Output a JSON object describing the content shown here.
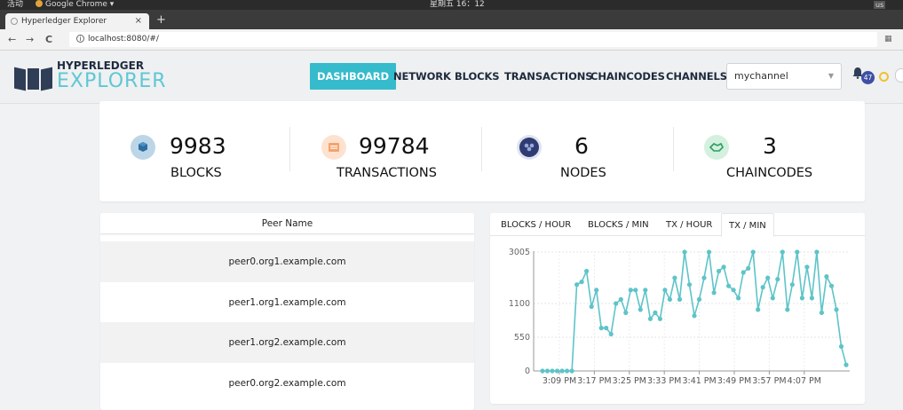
{
  "os": {
    "activities": "活动",
    "app_name": "Google Chrome ▾",
    "clock": "星期五 16：12",
    "keyboard": "us"
  },
  "browser": {
    "tab_title": "Hyperledger Explorer",
    "tab_close": "×",
    "new_tab": "+",
    "back": "←",
    "forward": "→",
    "reload": "C",
    "info": "i",
    "url": "localhost:8080/#/"
  },
  "logo": {
    "top": "HYPERLEDGER",
    "bottom": "EXPLORER"
  },
  "menu": [
    "DASHBOARD",
    "NETWORK",
    "BLOCKS",
    "TRANSACTIONS",
    "CHAINCODES",
    "CHANNELS"
  ],
  "channel": {
    "selected": "mychannel"
  },
  "notifications": {
    "count": "47"
  },
  "colors": {
    "accent": "#35bbcb",
    "line": "#5ec4c8",
    "navy": "#2f3e56"
  },
  "stats": [
    {
      "value": "9983",
      "label": "BLOCKS",
      "icon": "cube-icon",
      "icon_bg": "#bcd6e8"
    },
    {
      "value": "99784",
      "label": "TRANSACTIONS",
      "icon": "list-icon",
      "icon_bg": "#fde3cf"
    },
    {
      "value": "6",
      "label": "NODES",
      "icon": "users-icon",
      "icon_bg": "#dfe4ee"
    },
    {
      "value": "3",
      "label": "CHAINCODES",
      "icon": "handshake-icon",
      "icon_bg": "#d4f0de"
    }
  ],
  "peers": {
    "header": "Peer Name",
    "rows": [
      "peer0.org1.example.com",
      "peer1.org1.example.com",
      "peer1.org2.example.com",
      "peer0.org2.example.com"
    ]
  },
  "chart_tabs": [
    "BLOCKS / HOUR",
    "BLOCKS / MIN",
    "TX / HOUR",
    "TX / MIN"
  ],
  "chart_data": {
    "type": "line",
    "yticks": [
      0,
      550,
      1100,
      3005
    ],
    "xticks": [
      "3:09 PM",
      "3:17 PM",
      "3:25 PM",
      "3:33 PM",
      "3:41 PM",
      "3:49 PM",
      "3:57 PM",
      "4:07 PM"
    ],
    "grid": true,
    "values": [
      0,
      0,
      0,
      0,
      0,
      0,
      0,
      1800,
      1900,
      2300,
      1050,
      1600,
      700,
      700,
      600,
      1100,
      1250,
      950,
      1600,
      1600,
      1000,
      1600,
      850,
      950,
      850,
      1600,
      1250,
      2050,
      1250,
      3005,
      1800,
      900,
      1250,
      2050,
      3005,
      1500,
      2300,
      2450,
      1750,
      1600,
      1300,
      2250,
      2400,
      3005,
      1000,
      1700,
      2050,
      1300,
      2000,
      3005,
      1000,
      1800,
      3005,
      1300,
      2450,
      1300,
      3005,
      950,
      2100,
      1750,
      1000,
      400,
      100
    ]
  }
}
